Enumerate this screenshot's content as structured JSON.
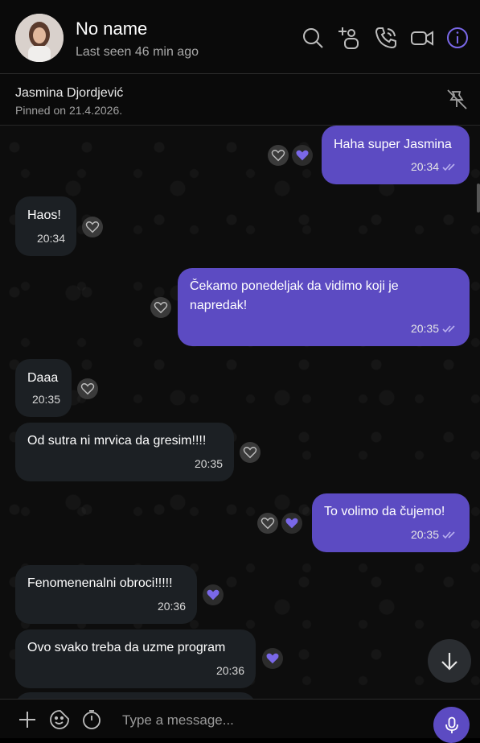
{
  "header": {
    "contact_name": "No name",
    "last_seen": "Last seen 46 min ago",
    "icons": [
      "search-icon",
      "add-participant-icon",
      "call-icon",
      "video-call-icon",
      "info-icon"
    ]
  },
  "pinned": {
    "name": "Jasmina Djordjević",
    "date": "Pinned on 21.4.2026."
  },
  "messages": [
    {
      "direction": "out",
      "text": "Haha super Jasmina",
      "time": "20:34",
      "reaction": "liked"
    },
    {
      "direction": "in",
      "text": "Haos!",
      "time": "20:34",
      "reaction": "none"
    },
    {
      "direction": "out",
      "text": "Čekamo ponedeljak da vidimo koji je napredak!",
      "time": "20:35",
      "reaction": "none"
    },
    {
      "direction": "in",
      "text": "Daaa",
      "time": "20:35",
      "reaction": "none"
    },
    {
      "direction": "in",
      "text": "Od sutra ni mrvica da gresim!!!!",
      "time": "20:35",
      "reaction": "none"
    },
    {
      "direction": "out",
      "text": "To volimo da čujemo!",
      "time": "20:35",
      "reaction": "liked"
    },
    {
      "direction": "in",
      "text": "Fenomenenalni obroci!!!!!",
      "time": "20:36",
      "reaction": "liked"
    },
    {
      "direction": "in",
      "text": "Ovo svako treba da uzme program",
      "time": "20:36",
      "reaction": "liked"
    }
  ],
  "composer": {
    "placeholder": "Type a message...",
    "icons": [
      "plus-icon",
      "sticker-icon",
      "timer-icon",
      "microphone-icon"
    ]
  },
  "colors": {
    "accent": "#5c4bc2",
    "incoming_bubble": "#1c2024",
    "background": "#0d0d0d"
  }
}
